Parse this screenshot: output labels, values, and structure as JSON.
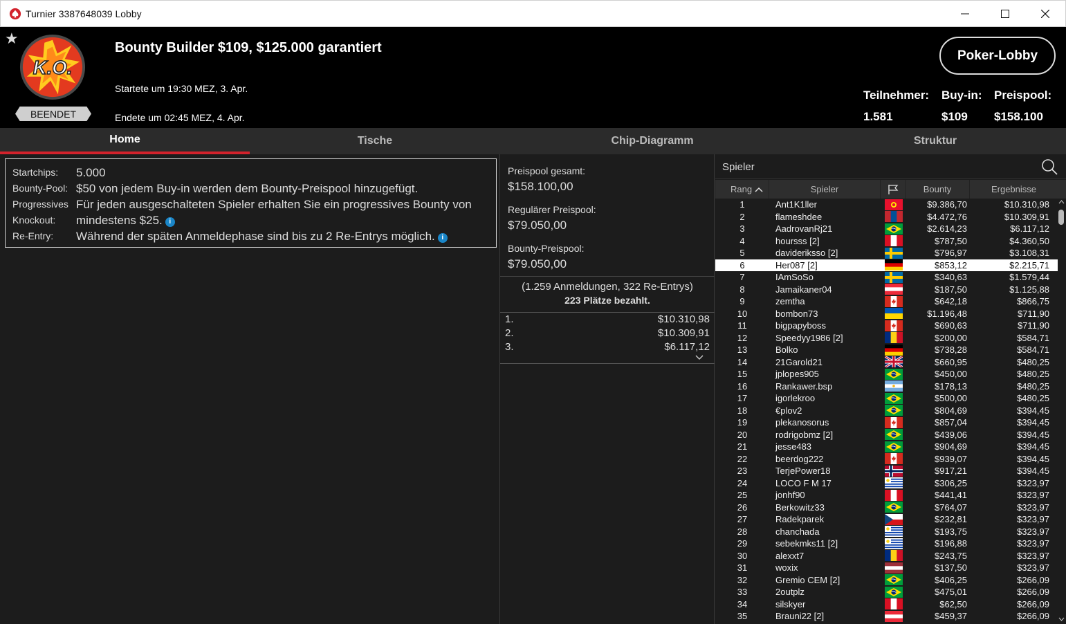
{
  "window": {
    "title": "Turnier 3387648039 Lobby"
  },
  "header": {
    "status": "BEENDET",
    "logo_text": "K.O.",
    "title": "Bounty Builder $109, $125.000 garantiert",
    "started": "Startete um 19:30 MEZ, 3. Apr.",
    "ended": "Endete um 02:45 MEZ, 4. Apr.",
    "lobby_button": "Poker-Lobby",
    "stats": {
      "participants_label": "Teilnehmer:",
      "participants_value": "1.581",
      "buyin_label": "Buy-in:",
      "buyin_value": "$109",
      "prizepool_label": "Preispool:",
      "prizepool_value": "$158.100"
    }
  },
  "tabs": [
    "Home",
    "Tische",
    "Chip-Diagramm",
    "Struktur"
  ],
  "info": {
    "startchips_label": "Startchips:",
    "startchips_value": "5.000",
    "bounty_label": "Bounty-Pool:",
    "bounty_value": "$50 von jedem Buy-in werden dem Bounty-Preispool hinzugefügt.",
    "pko_label_1": "Progressives",
    "pko_label_2": "Knockout:",
    "pko_value_1": "Für jeden ausgeschalteten Spieler erhalten Sie ein progressives Bounty von",
    "pko_value_2": "mindestens $25.",
    "reentry_label": "Re-Entry:",
    "reentry_value": "Während der späten Anmeldephase sind bis zu 2 Re-Entrys möglich."
  },
  "prize": {
    "total_label": "Preispool gesamt:",
    "total_value": "$158.100,00",
    "regular_label": "Regulärer Preispool:",
    "regular_value": "$79.050,00",
    "bounty_label": "Bounty-Preispool:",
    "bounty_value": "$79.050,00",
    "entries_note": "(1.259 Anmeldungen, 322 Re-Entrys)",
    "paid_note": "223 Plätze bezahlt.",
    "payouts": [
      {
        "place": "1.",
        "amount": "$10.310,98"
      },
      {
        "place": "2.",
        "amount": "$10.309,91"
      },
      {
        "place": "3.",
        "amount": "$6.117,12"
      }
    ]
  },
  "players": {
    "search_placeholder": "Spieler",
    "columns": {
      "rank": "Rang",
      "player": "Spieler",
      "bounty": "Bounty",
      "result": "Ergebnisse"
    },
    "selected_rank": "6",
    "rows": [
      {
        "rank": "1",
        "name": "Ant1K1ller",
        "flag": "kyrgyzstan",
        "bounty": "$9.386,70",
        "result": "$10.310,98"
      },
      {
        "rank": "2",
        "name": "flameshdee",
        "flag": "mongolia",
        "bounty": "$4.472,76",
        "result": "$10.309,91"
      },
      {
        "rank": "3",
        "name": "AadrovanRj21",
        "flag": "brazil",
        "bounty": "$2.614,23",
        "result": "$6.117,12"
      },
      {
        "rank": "4",
        "name": "hoursss [2]",
        "flag": "peru",
        "bounty": "$787,50",
        "result": "$4.360,50"
      },
      {
        "rank": "5",
        "name": "davideriksso [2]",
        "flag": "sweden",
        "bounty": "$796,97",
        "result": "$3.108,31"
      },
      {
        "rank": "6",
        "name": "Her087 [2]",
        "flag": "germany",
        "bounty": "$853,12",
        "result": "$2.215,71"
      },
      {
        "rank": "7",
        "name": "IAmSoSo",
        "flag": "sweden",
        "bounty": "$340,63",
        "result": "$1.579,44"
      },
      {
        "rank": "8",
        "name": "Jamaikaner04",
        "flag": "austria",
        "bounty": "$187,50",
        "result": "$1.125,88"
      },
      {
        "rank": "9",
        "name": "zemtha",
        "flag": "canada",
        "bounty": "$642,18",
        "result": "$866,75"
      },
      {
        "rank": "10",
        "name": "bombon73",
        "flag": "ukraine",
        "bounty": "$1.196,48",
        "result": "$711,90"
      },
      {
        "rank": "11",
        "name": "bigpapyboss",
        "flag": "canada",
        "bounty": "$690,63",
        "result": "$711,90"
      },
      {
        "rank": "12",
        "name": "Speedyy1986 [2]",
        "flag": "romania",
        "bounty": "$200,00",
        "result": "$584,71"
      },
      {
        "rank": "13",
        "name": "Bolko",
        "flag": "germany",
        "bounty": "$738,28",
        "result": "$584,71"
      },
      {
        "rank": "14",
        "name": "21Garold21",
        "flag": "uk",
        "bounty": "$660,95",
        "result": "$480,25"
      },
      {
        "rank": "15",
        "name": "jplopes905",
        "flag": "brazil",
        "bounty": "$450,00",
        "result": "$480,25"
      },
      {
        "rank": "16",
        "name": "Rankawer.bsp",
        "flag": "argentina",
        "bounty": "$178,13",
        "result": "$480,25"
      },
      {
        "rank": "17",
        "name": "igorlekroo",
        "flag": "brazil",
        "bounty": "$500,00",
        "result": "$480,25"
      },
      {
        "rank": "18",
        "name": "€plov2",
        "flag": "brazil",
        "bounty": "$804,69",
        "result": "$394,45"
      },
      {
        "rank": "19",
        "name": "plekanosorus",
        "flag": "canada",
        "bounty": "$857,04",
        "result": "$394,45"
      },
      {
        "rank": "20",
        "name": "rodrigobmz [2]",
        "flag": "brazil",
        "bounty": "$439,06",
        "result": "$394,45"
      },
      {
        "rank": "21",
        "name": "jesse483",
        "flag": "brazil",
        "bounty": "$904,69",
        "result": "$394,45"
      },
      {
        "rank": "22",
        "name": "beerdog222",
        "flag": "canada",
        "bounty": "$939,07",
        "result": "$394,45"
      },
      {
        "rank": "23",
        "name": "TerjePower18",
        "flag": "norway",
        "bounty": "$917,21",
        "result": "$394,45"
      },
      {
        "rank": "24",
        "name": "LOCO F M 17",
        "flag": "uruguay",
        "bounty": "$306,25",
        "result": "$323,97"
      },
      {
        "rank": "25",
        "name": "jonhf90",
        "flag": "peru",
        "bounty": "$441,41",
        "result": "$323,97"
      },
      {
        "rank": "26",
        "name": "Berkowitz33",
        "flag": "brazil",
        "bounty": "$764,07",
        "result": "$323,97"
      },
      {
        "rank": "27",
        "name": "Radekparek",
        "flag": "czech",
        "bounty": "$232,81",
        "result": "$323,97"
      },
      {
        "rank": "28",
        "name": "chanchada",
        "flag": "uruguay",
        "bounty": "$193,75",
        "result": "$323,97"
      },
      {
        "rank": "29",
        "name": "sebekmks11 [2]",
        "flag": "uruguay",
        "bounty": "$196,88",
        "result": "$323,97"
      },
      {
        "rank": "30",
        "name": "alexxt7",
        "flag": "romania",
        "bounty": "$243,75",
        "result": "$323,97"
      },
      {
        "rank": "31",
        "name": "woxix",
        "flag": "latvia",
        "bounty": "$137,50",
        "result": "$323,97"
      },
      {
        "rank": "32",
        "name": "Gremio CEM [2]",
        "flag": "brazil",
        "bounty": "$406,25",
        "result": "$266,09"
      },
      {
        "rank": "33",
        "name": "2outplz",
        "flag": "brazil",
        "bounty": "$475,01",
        "result": "$266,09"
      },
      {
        "rank": "34",
        "name": "silskyer",
        "flag": "peru",
        "bounty": "$62,50",
        "result": "$266,09"
      },
      {
        "rank": "35",
        "name": "Brauni22 [2]",
        "flag": "austria",
        "bounty": "$459,37",
        "result": "$266,09"
      }
    ]
  },
  "colors": {
    "accent_red": "#d3222c",
    "background": "#1c1c1c",
    "header": "#000000",
    "info_icon": "#1a86c8"
  },
  "icons": [
    "pokerstars-spade-icon",
    "star-icon",
    "ko-logo",
    "search-icon",
    "flag-column-icon",
    "sort-up-icon",
    "chevron-down-icon",
    "info-icon"
  ]
}
